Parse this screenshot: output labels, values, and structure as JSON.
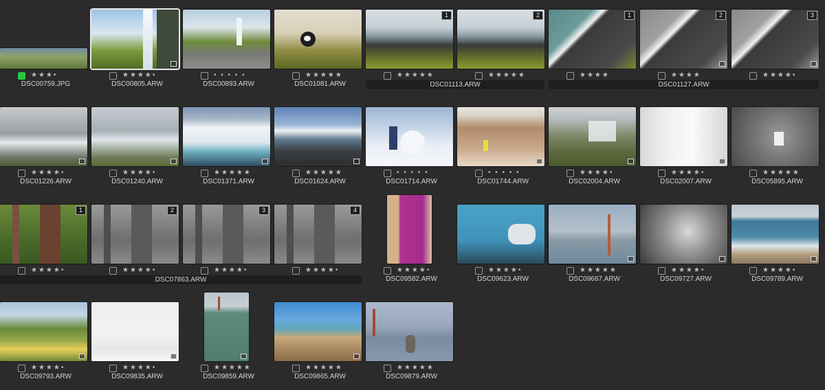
{
  "colors": {
    "flag_green": "#27c93f",
    "selection": "#e8e8e8",
    "background": "#2b2b2b"
  },
  "grid": {
    "items": [
      {
        "file": "DSC00759.JPG",
        "stars": "★★★•",
        "flag": true
      },
      {
        "file": "DSC00805.ARW",
        "stars": "★★★★•",
        "selected": true,
        "badge": true
      },
      {
        "file": "DSC00893.ARW",
        "stars": "• • • • •"
      },
      {
        "file": "DSC01081.ARW",
        "stars": "★★★★★"
      },
      {
        "file": "",
        "stars": "★★★★★",
        "stack": "1"
      },
      {
        "file": "",
        "stars": "★★★★★",
        "stack": "2"
      },
      {
        "file": "",
        "stars": "★★★★",
        "stack": "1"
      },
      {
        "file": "",
        "stars": "★★★★",
        "stack": "2",
        "badge": true
      },
      {
        "file": "",
        "stars": "★★★★•",
        "stack": "3",
        "badge": true
      },
      {
        "file": "DSC01226.ARW",
        "stars": "★★★★•",
        "badge": true
      },
      {
        "file": "DSC01240.ARW",
        "stars": "★★★★•",
        "badge": true
      },
      {
        "file": "DSC01371.ARW",
        "stars": "★★★★★",
        "badge": true
      },
      {
        "file": "DSC01624.ARW",
        "stars": "★★★★★",
        "badge": true
      },
      {
        "file": "DSC01714.ARW",
        "stars": "• • • • •"
      },
      {
        "file": "DSC01744.ARW",
        "stars": "• • • • •",
        "badge": true
      },
      {
        "file": "DSC02004.ARW",
        "stars": "★★★★•",
        "badge": true
      },
      {
        "file": "DSC02007.ARW",
        "stars": "★★★★•",
        "badge": true
      },
      {
        "file": "DSC05895.ARW",
        "stars": "★★★★★"
      },
      {
        "file": "",
        "stars": "★★★★•",
        "stack": "1"
      },
      {
        "file": "",
        "stars": "★★★★•",
        "stack": "2"
      },
      {
        "file": "",
        "stars": "★★★★•",
        "stack": "3"
      },
      {
        "file": "",
        "stars": "★★★★•",
        "stack": "4"
      },
      {
        "file": "DSC09582.ARW",
        "stars": "★★★★•"
      },
      {
        "file": "DSC09623.ARW",
        "stars": "★★★★•"
      },
      {
        "file": "DSC09687.ARW",
        "stars": "★★★★★",
        "badge": true
      },
      {
        "file": "DSC09727.ARW",
        "stars": "★★★★•",
        "badge": true
      },
      {
        "file": "DSC09789.ARW",
        "stars": "★★★★•",
        "badge": true
      },
      {
        "file": "DSC09793.ARW",
        "stars": "★★★★•",
        "badge": true
      },
      {
        "file": "DSC09835.ARW",
        "stars": "★★★★•",
        "badge": true
      },
      {
        "file": "DSC09859.ARW",
        "stars": "★★★★★",
        "badge": true
      },
      {
        "file": "DSC09865.ARW",
        "stars": "★★★★★",
        "badge": true
      },
      {
        "file": "DSC09879.ARW",
        "stars": "★★★★★"
      }
    ],
    "stacks": [
      "DSC01113.ARW",
      "DSC01127.ARW",
      "DSC07863.ARW"
    ]
  }
}
